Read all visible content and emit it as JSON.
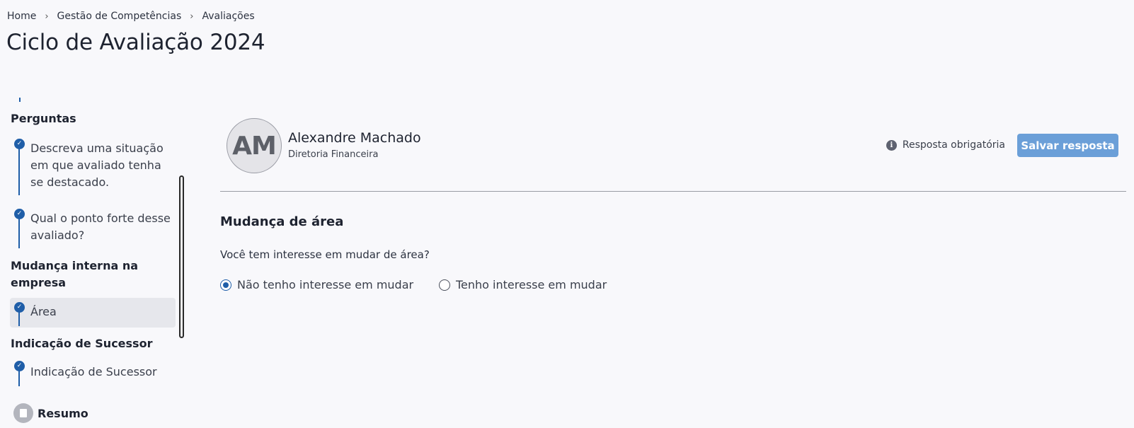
{
  "breadcrumb": [
    "Home",
    "Gestão de Competências",
    "Avaliações"
  ],
  "page_title": "Ciclo de Avaliação 2024",
  "sidebar": {
    "sections": [
      {
        "title": "Perguntas",
        "steps": [
          {
            "label": "Descreva uma situação em que avaliado tenha se destacado.",
            "completed": true
          },
          {
            "label": "Qual o ponto forte desse avaliado?",
            "completed": true
          }
        ]
      },
      {
        "title": "Mudança interna na empresa",
        "steps": [
          {
            "label": "Área",
            "completed": true,
            "active": true
          }
        ]
      },
      {
        "title": "Indicação de Sucessor",
        "steps": [
          {
            "label": "Indicação de Sucessor",
            "completed": true
          }
        ]
      }
    ],
    "summary_label": "Resumo"
  },
  "evaluee": {
    "initials": "AM",
    "name": "Alexandre Machado",
    "department": "Diretoria Financeira"
  },
  "required_label": "Resposta obrigatória",
  "save_label": "Salvar resposta",
  "question": {
    "section_title": "Mudança de área",
    "text": "Você tem interesse em mudar de área?",
    "options": [
      {
        "label": "Não tenho interesse em mudar",
        "selected": true
      },
      {
        "label": "Tenho interesse em mudar",
        "selected": false
      }
    ]
  },
  "colors": {
    "accent": "#1f5ea8",
    "button": "#6b9fd8",
    "background": "#f8f8fb"
  }
}
